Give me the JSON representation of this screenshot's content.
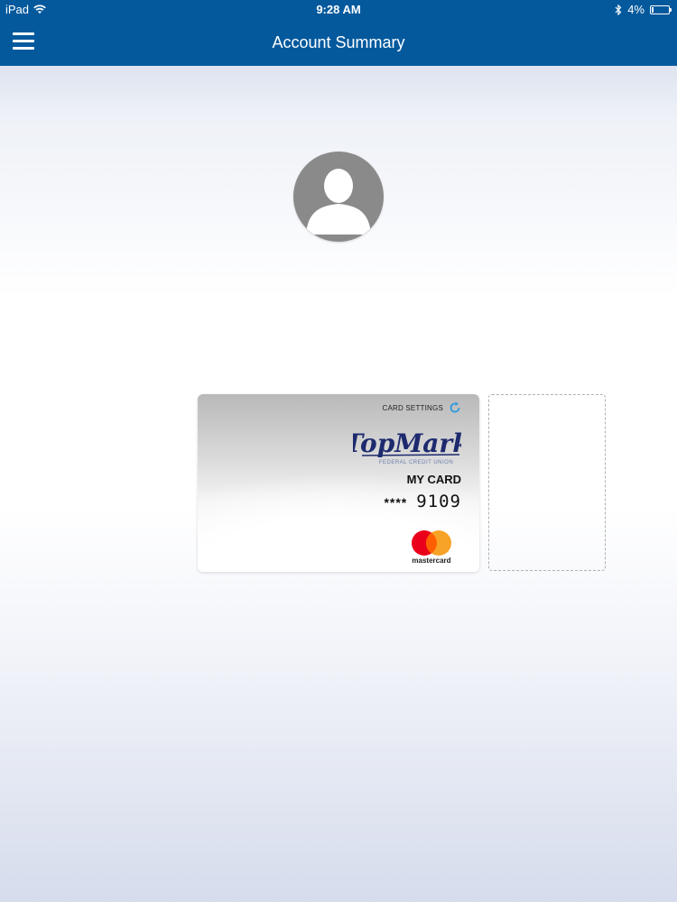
{
  "status_bar": {
    "device": "iPad",
    "time": "9:28 AM",
    "battery": "4%"
  },
  "navbar": {
    "title": "Account Summary"
  },
  "card": {
    "settings_label": "CARD SETTINGS",
    "brand": "TopMark",
    "brand_subtitle": "FEDERAL CREDIT UNION",
    "name": "MY CARD",
    "mask": "****",
    "last4": "9109",
    "network": "mastercard"
  },
  "colors": {
    "header_blue": "#04599d",
    "brand_navy": "#1d2a6e",
    "mastercard_red": "#eb001b",
    "mastercard_orange": "#f79e1b",
    "refresh_blue": "#2e9ae0"
  },
  "icons": {
    "menu": "hamburger-icon",
    "wifi": "wifi-icon",
    "bluetooth": "bluetooth-icon",
    "battery": "battery-icon",
    "avatar": "user-placeholder-icon",
    "card_settings": "refresh-icon"
  }
}
